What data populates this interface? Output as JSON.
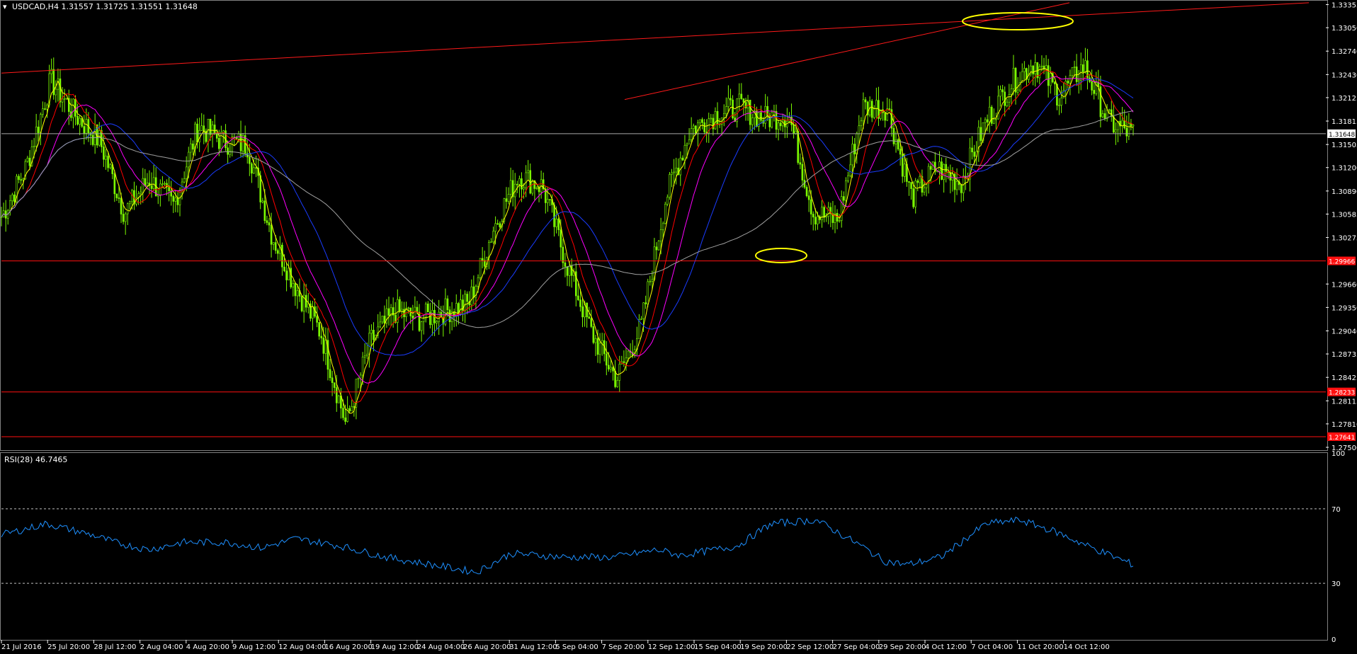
{
  "main_panel": {
    "symbol_header": "USDCAD,H4  1.31557 1.31725 1.31551 1.31648",
    "price_axis_labels": [
      "1.33355",
      "1.33050",
      "1.32740",
      "1.32430",
      "1.32125",
      "1.31815",
      "1.31505",
      "1.31200",
      "1.30890",
      "1.30585",
      "1.30275",
      "1.29660",
      "1.29350",
      "1.29040",
      "1.28735",
      "1.28425",
      "1.28115",
      "1.27810",
      "1.27500"
    ],
    "current_price_tag": "1.31648",
    "level_tags": [
      "1.29966",
      "1.28233",
      "1.27641"
    ],
    "date_labels": [
      "21 Jul 2016",
      "25 Jul 20:00",
      "28 Jul 12:00",
      "2 Aug 04:00",
      "4 Aug 20:00",
      "9 Aug 12:00",
      "12 Aug 04:00",
      "16 Aug 20:00",
      "19 Aug 12:00",
      "24 Aug 04:00",
      "26 Aug 20:00",
      "31 Aug 12:00",
      "5 Sep 04:00",
      "7 Sep 20:00",
      "12 Sep 12:00",
      "15 Sep 04:00",
      "19 Sep 20:00",
      "22 Sep 12:00",
      "27 Sep 04:00",
      "29 Sep 20:00",
      "4 Oct 12:00",
      "7 Oct 04:00",
      "11 Oct 20:00",
      "14 Oct 12:00"
    ]
  },
  "rsi_panel": {
    "header": "RSI(28) 46.7465",
    "scale_labels": [
      "100",
      "70",
      "30",
      "0"
    ]
  },
  "colors": {
    "background": "#000000",
    "candles": "#7CFC00",
    "level_line": "#ff1010",
    "trendline": "#ff1a1a",
    "ellipse": "#ffff00",
    "ma_yellow": "#ffff00",
    "ma_red": "#ff0000",
    "ma_magenta": "#ff00ff",
    "ma_blue": "#1a3cff",
    "ma_grey": "#a0a0a0",
    "rsi_line": "#1e90ff",
    "axis_text": "#ffffff"
  },
  "chart_data": {
    "type": "candlestick",
    "symbol": "USDCAD",
    "timeframe": "H4",
    "ohlc_last": {
      "open": 1.31557,
      "high": 1.31725,
      "low": 1.31551,
      "close": 1.31648
    },
    "x_range": [
      "21 Jul 2016",
      "14 Oct 12:00"
    ],
    "ylim": [
      1.275,
      1.3336
    ],
    "horizontal_levels": [
      1.29966,
      1.28233,
      1.27641
    ],
    "current_price": 1.31648,
    "close_path": [
      [
        "21 Jul 2016",
        1.3055
      ],
      [
        "23 Jul",
        1.312
      ],
      [
        "25 Jul 20:00",
        1.3235
      ],
      [
        "27 Jul",
        1.319
      ],
      [
        "28 Jul 12:00",
        1.3155
      ],
      [
        "30 Jul",
        1.306
      ],
      [
        "2 Aug 04:00",
        1.3105
      ],
      [
        "3 Aug",
        1.307
      ],
      [
        "4 Aug 20:00",
        1.3175
      ],
      [
        "7 Aug",
        1.3155
      ],
      [
        "9 Aug 12:00",
        1.315
      ],
      [
        "11 Aug",
        1.303
      ],
      [
        "12 Aug 04:00",
        1.296
      ],
      [
        "14 Aug",
        1.29
      ],
      [
        "16 Aug 20:00",
        1.278
      ],
      [
        "18 Aug",
        1.289
      ],
      [
        "19 Aug 12:00",
        1.293
      ],
      [
        "22 Aug",
        1.292
      ],
      [
        "24 Aug 04:00",
        1.293
      ],
      [
        "25 Aug",
        1.294
      ],
      [
        "26 Aug 20:00",
        1.304
      ],
      [
        "29 Aug",
        1.311
      ],
      [
        "31 Aug 12:00",
        1.3095
      ],
      [
        "2 Sep",
        1.299
      ],
      [
        "5 Sep 04:00",
        1.29
      ],
      [
        "6 Sep",
        1.284
      ],
      [
        "7 Sep 20:00",
        1.291
      ],
      [
        "10 Sep",
        1.308
      ],
      [
        "12 Sep 12:00",
        1.317
      ],
      [
        "14 Sep",
        1.319
      ],
      [
        "15 Sep 04:00",
        1.32
      ],
      [
        "17 Sep",
        1.3185
      ],
      [
        "19 Sep 20:00",
        1.319
      ],
      [
        "21 Sep",
        1.306
      ],
      [
        "22 Sep 12:00",
        1.305
      ],
      [
        "25 Sep",
        1.32
      ],
      [
        "27 Sep 04:00",
        1.32
      ],
      [
        "28 Sep",
        1.308
      ],
      [
        "29 Sep 20:00",
        1.312
      ],
      [
        "2 Oct",
        1.31
      ],
      [
        "4 Oct 12:00",
        1.318
      ],
      [
        "6 Oct",
        1.323
      ],
      [
        "7 Oct 04:00",
        1.326
      ],
      [
        "9 Oct",
        1.3215
      ],
      [
        "11 Oct 20:00",
        1.3255
      ],
      [
        "13 Oct",
        1.318
      ],
      [
        "14 Oct 12:00",
        1.31648
      ]
    ],
    "annotations": [
      {
        "type": "trendline",
        "note": "long rising resistance line from left edge to top-right"
      },
      {
        "type": "trendline",
        "note": "steeper rising line from mid-September highs"
      },
      {
        "type": "ellipse",
        "note": "marks the October double-top highs near 1.3305"
      },
      {
        "type": "ellipse",
        "note": "marks the 22 Sep low near 1.2998"
      }
    ],
    "rsi": {
      "period": 28,
      "last": 46.7465,
      "levels": [
        70,
        30
      ],
      "ylim": [
        0,
        100
      ],
      "path": [
        [
          0,
          56
        ],
        [
          0.04,
          62
        ],
        [
          0.08,
          56
        ],
        [
          0.1,
          52
        ],
        [
          0.13,
          48
        ],
        [
          0.16,
          52
        ],
        [
          0.2,
          52
        ],
        [
          0.23,
          49
        ],
        [
          0.26,
          54
        ],
        [
          0.3,
          50
        ],
        [
          0.34,
          44
        ],
        [
          0.38,
          40
        ],
        [
          0.42,
          36
        ],
        [
          0.45,
          46
        ],
        [
          0.5,
          44
        ],
        [
          0.54,
          44
        ],
        [
          0.58,
          48
        ],
        [
          0.6,
          45
        ],
        [
          0.65,
          50
        ],
        [
          0.68,
          62
        ],
        [
          0.72,
          64
        ],
        [
          0.76,
          50
        ],
        [
          0.78,
          42
        ],
        [
          0.8,
          40
        ],
        [
          0.83,
          44
        ],
        [
          0.87,
          62
        ],
        [
          0.9,
          64
        ],
        [
          0.93,
          58
        ],
        [
          0.96,
          50
        ],
        [
          1,
          40
        ]
      ]
    }
  }
}
